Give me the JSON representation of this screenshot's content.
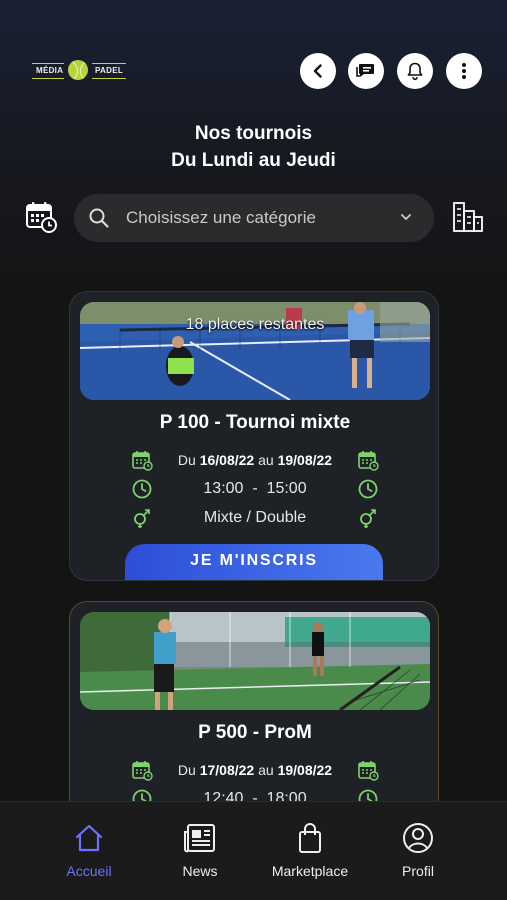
{
  "logo": {
    "left_text": "MÉDIA",
    "right_text": "PADEL"
  },
  "header": {
    "title_line1": "Nos tournois",
    "title_line2": "Du Lundi au Jeudi"
  },
  "search": {
    "placeholder": "Choisissez une catégorie"
  },
  "colors": {
    "accent": "#4a6cf0",
    "nav_active": "#6b72ff",
    "icon_green": "#7fd36a",
    "background": "#141414"
  },
  "tournaments": [
    {
      "places": "18 places restantes",
      "title": "P 100 - Tournoi mixte",
      "date_prefix": "Du",
      "date_start": "16/08/22",
      "date_mid": "au",
      "date_end": "19/08/22",
      "time_start": "13:00",
      "time_sep": "-",
      "time_end": "15:00",
      "category": "Mixte / Double",
      "cta": "JE M'INSCRIS"
    },
    {
      "title": "P 500 - ProM",
      "date_prefix": "Du",
      "date_start": "17/08/22",
      "date_mid": "au",
      "date_end": "19/08/22",
      "time_start": "12:40",
      "time_sep": "-",
      "time_end": "18:00"
    }
  ],
  "nav": [
    {
      "label": "Accueil",
      "icon": "home-icon",
      "active": true
    },
    {
      "label": "News",
      "icon": "newspaper-icon"
    },
    {
      "label": "Marketplace",
      "icon": "shopping-bag-icon"
    },
    {
      "label": "Profil",
      "icon": "user-icon"
    }
  ]
}
